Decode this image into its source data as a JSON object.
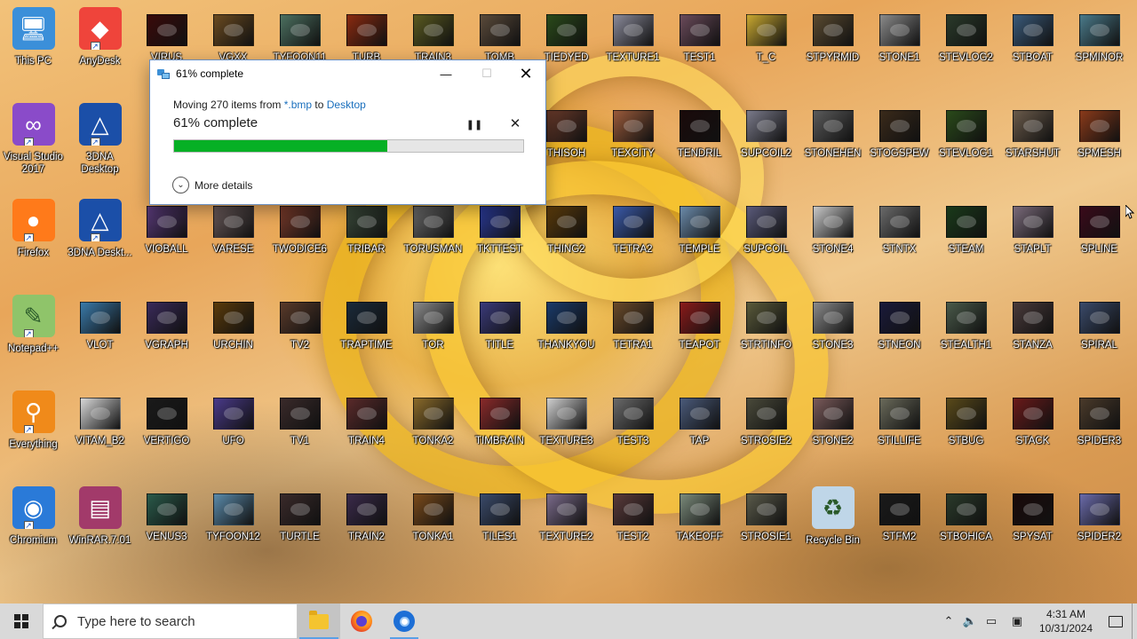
{
  "desktop": {
    "icons": [
      {
        "label": "This PC",
        "kind": "thispc",
        "col": 0,
        "row": 0,
        "shortcut": false
      },
      {
        "label": "AnyDesk",
        "kind": "anydesk",
        "col": 1,
        "row": 0,
        "shortcut": true
      },
      {
        "label": "VIRUS",
        "kind": "thumb",
        "color": "#3a0a0a",
        "col": 2,
        "row": 0
      },
      {
        "label": "VGXX",
        "kind": "thumb",
        "color": "#6a4a20",
        "col": 3,
        "row": 0
      },
      {
        "label": "TYFOON11",
        "kind": "thumb",
        "color": "#4c7060",
        "col": 4,
        "row": 0
      },
      {
        "label": "TURB",
        "kind": "thumb",
        "color": "#8a2a10",
        "col": 5,
        "row": 0
      },
      {
        "label": "TRAIN3",
        "kind": "thumb",
        "color": "#5a5a20",
        "col": 6,
        "row": 0
      },
      {
        "label": "TOMB",
        "kind": "thumb",
        "color": "#5a4a3a",
        "col": 7,
        "row": 0
      },
      {
        "label": "TIEDYED",
        "kind": "thumb",
        "color": "#2a4a1a",
        "col": 8,
        "row": 0
      },
      {
        "label": "TEXTURE1",
        "kind": "thumb",
        "color": "#8a8a9a",
        "col": 9,
        "row": 0
      },
      {
        "label": "TEST1",
        "kind": "thumb",
        "color": "#6a4a5a",
        "col": 10,
        "row": 0
      },
      {
        "label": "T_C",
        "kind": "thumb",
        "color": "#c9a830",
        "col": 11,
        "row": 0
      },
      {
        "label": "STPYRMID",
        "kind": "thumb",
        "color": "#5a4a30",
        "col": 12,
        "row": 0
      },
      {
        "label": "STONE1",
        "kind": "thumb",
        "color": "#8a8a8a",
        "col": 13,
        "row": 0
      },
      {
        "label": "STEVLOG2",
        "kind": "thumb",
        "color": "#2a3a2a",
        "col": 14,
        "row": 0
      },
      {
        "label": "STBOAT",
        "kind": "thumb",
        "color": "#3a5a7a",
        "col": 15,
        "row": 0
      },
      {
        "label": "SPMINOR",
        "kind": "thumb",
        "color": "#4a7a8a",
        "col": 16,
        "row": 0
      },
      {
        "label": "Visual Studio 2017",
        "kind": "vs",
        "col": 0,
        "row": 1,
        "shortcut": true
      },
      {
        "label": "3DNA Desktop",
        "kind": "dna",
        "col": 1,
        "row": 1,
        "shortcut": true
      },
      {
        "label": "THISOH",
        "kind": "thumb",
        "color": "#6a3a2a",
        "col": 8,
        "row": 1
      },
      {
        "label": "TEXCITY",
        "kind": "thumb",
        "color": "#9a5a3a",
        "col": 9,
        "row": 1
      },
      {
        "label": "TENDRIL",
        "kind": "thumb",
        "color": "#1a0a0a",
        "col": 10,
        "row": 1
      },
      {
        "label": "SUPCOIL2",
        "kind": "thumb",
        "color": "#7a7a8a",
        "col": 11,
        "row": 1
      },
      {
        "label": "STONEHEN",
        "kind": "thumb",
        "color": "#5a5a5a",
        "col": 12,
        "row": 1
      },
      {
        "label": "STOGSPEW",
        "kind": "thumb",
        "color": "#3a2a1a",
        "col": 13,
        "row": 1
      },
      {
        "label": "STEVLOG1",
        "kind": "thumb",
        "color": "#2a4a1a",
        "col": 14,
        "row": 1
      },
      {
        "label": "STARSHUT",
        "kind": "thumb",
        "color": "#6a5a4a",
        "col": 15,
        "row": 1
      },
      {
        "label": "SPMESH",
        "kind": "thumb",
        "color": "#8a3a1a",
        "col": 16,
        "row": 1
      },
      {
        "label": "Firefox",
        "kind": "firefox",
        "col": 0,
        "row": 2,
        "shortcut": true
      },
      {
        "label": "3DNA Deskt...",
        "kind": "dna",
        "col": 1,
        "row": 2,
        "shortcut": true
      },
      {
        "label": "VIOBALL",
        "kind": "thumb",
        "color": "#5a3a7a",
        "col": 2,
        "row": 2
      },
      {
        "label": "VARESE",
        "kind": "thumb",
        "color": "#6a5a5a",
        "col": 3,
        "row": 2
      },
      {
        "label": "TWODICE6",
        "kind": "thumb",
        "color": "#7a3a2a",
        "col": 4,
        "row": 2
      },
      {
        "label": "TRIBAR",
        "kind": "thumb",
        "color": "#3a4a3a",
        "col": 5,
        "row": 2
      },
      {
        "label": "TORUSMAN",
        "kind": "thumb",
        "color": "#6a6a6a",
        "col": 6,
        "row": 2
      },
      {
        "label": "TKTTEST",
        "kind": "thumb",
        "color": "#2a3a9a",
        "col": 7,
        "row": 2
      },
      {
        "label": "THING2",
        "kind": "thumb",
        "color": "#5a3a0a",
        "col": 8,
        "row": 2
      },
      {
        "label": "TETRA2",
        "kind": "thumb",
        "color": "#3a5aaa",
        "col": 9,
        "row": 2
      },
      {
        "label": "TEMPLE",
        "kind": "thumb",
        "color": "#6a8aaa",
        "col": 10,
        "row": 2
      },
      {
        "label": "SUPCOIL",
        "kind": "thumb",
        "color": "#5a5a7a",
        "col": 11,
        "row": 2
      },
      {
        "label": "STONE4",
        "kind": "thumb",
        "color": "#c8c8c8",
        "col": 12,
        "row": 2
      },
      {
        "label": "STNTX",
        "kind": "thumb",
        "color": "#6a6a6a",
        "col": 13,
        "row": 2
      },
      {
        "label": "STEAM",
        "kind": "thumb",
        "color": "#1a3a1a",
        "col": 14,
        "row": 2
      },
      {
        "label": "STAPLT",
        "kind": "thumb",
        "color": "#7a6a7a",
        "col": 15,
        "row": 2
      },
      {
        "label": "SPLINE",
        "kind": "thumb",
        "color": "#3a0a1a",
        "col": 16,
        "row": 2
      },
      {
        "label": "Notepad++",
        "kind": "notepad",
        "col": 0,
        "row": 3,
        "shortcut": true
      },
      {
        "label": "VLOT",
        "kind": "thumb",
        "color": "#3a7aaa",
        "col": 1,
        "row": 3
      },
      {
        "label": "VGRAPH",
        "kind": "thumb",
        "color": "#3a2a5a",
        "col": 2,
        "row": 3
      },
      {
        "label": "URCHIN",
        "kind": "thumb",
        "color": "#5a3a0a",
        "col": 3,
        "row": 3
      },
      {
        "label": "TV2",
        "kind": "thumb",
        "color": "#5a3a2a",
        "col": 4,
        "row": 3
      },
      {
        "label": "TRAPTIME",
        "kind": "thumb",
        "color": "#1a2a3a",
        "col": 5,
        "row": 3
      },
      {
        "label": "TOR",
        "kind": "thumb",
        "color": "#8a8a8a",
        "col": 6,
        "row": 3
      },
      {
        "label": "TITLE",
        "kind": "thumb",
        "color": "#3a3a7a",
        "col": 7,
        "row": 3
      },
      {
        "label": "THANKYOU",
        "kind": "thumb",
        "color": "#1a3a6a",
        "col": 8,
        "row": 3
      },
      {
        "label": "TETRA1",
        "kind": "thumb",
        "color": "#6a4a2a",
        "col": 9,
        "row": 3
      },
      {
        "label": "TEAPOT",
        "kind": "thumb",
        "color": "#8a1a1a",
        "col": 10,
        "row": 3
      },
      {
        "label": "STRTINFO",
        "kind": "thumb",
        "color": "#5a5a3a",
        "col": 11,
        "row": 3
      },
      {
        "label": "STONE3",
        "kind": "thumb",
        "color": "#8a8a8a",
        "col": 12,
        "row": 3
      },
      {
        "label": "STNEON",
        "kind": "thumb",
        "color": "#1a1a3a",
        "col": 13,
        "row": 3
      },
      {
        "label": "STEALTH1",
        "kind": "thumb",
        "color": "#4a5a4a",
        "col": 14,
        "row": 3
      },
      {
        "label": "STANZA",
        "kind": "thumb",
        "color": "#4a3a3a",
        "col": 15,
        "row": 3
      },
      {
        "label": "SPIRAL",
        "kind": "thumb",
        "color": "#3a4a6a",
        "col": 16,
        "row": 3
      },
      {
        "label": "Everything",
        "kind": "everything",
        "col": 0,
        "row": 4,
        "shortcut": true
      },
      {
        "label": "VITAM_B2",
        "kind": "thumb",
        "color": "#d8d8d8",
        "col": 1,
        "row": 4
      },
      {
        "label": "VERTIGO",
        "kind": "thumb",
        "color": "#1a1a1a",
        "col": 2,
        "row": 4
      },
      {
        "label": "UFO",
        "kind": "thumb",
        "color": "#4a3a8a",
        "col": 3,
        "row": 4
      },
      {
        "label": "TV1",
        "kind": "thumb",
        "color": "#3a2a2a",
        "col": 4,
        "row": 4
      },
      {
        "label": "TRAIN4",
        "kind": "thumb",
        "color": "#5a2a2a",
        "col": 5,
        "row": 4
      },
      {
        "label": "TONKA2",
        "kind": "thumb",
        "color": "#8a6a2a",
        "col": 6,
        "row": 4
      },
      {
        "label": "TIMBRAIN",
        "kind": "thumb",
        "color": "#8a2a2a",
        "col": 7,
        "row": 4
      },
      {
        "label": "TEXTURE3",
        "kind": "thumb",
        "color": "#d0d0d0",
        "col": 8,
        "row": 4
      },
      {
        "label": "TEST3",
        "kind": "thumb",
        "color": "#6a6a6a",
        "col": 9,
        "row": 4
      },
      {
        "label": "TAP",
        "kind": "thumb",
        "color": "#4a5a7a",
        "col": 10,
        "row": 4
      },
      {
        "label": "STROSIE2",
        "kind": "thumb",
        "color": "#4a4a3a",
        "col": 11,
        "row": 4
      },
      {
        "label": "STONE2",
        "kind": "thumb",
        "color": "#7a5a5a",
        "col": 12,
        "row": 4
      },
      {
        "label": "STILLIFE",
        "kind": "thumb",
        "color": "#6a6a5a",
        "col": 13,
        "row": 4
      },
      {
        "label": "STBUG",
        "kind": "thumb",
        "color": "#5a4a1a",
        "col": 14,
        "row": 4
      },
      {
        "label": "STACK",
        "kind": "thumb",
        "color": "#6a1a1a",
        "col": 15,
        "row": 4
      },
      {
        "label": "SPIDER3",
        "kind": "thumb",
        "color": "#4a3a2a",
        "col": 16,
        "row": 4
      },
      {
        "label": "Chromium",
        "kind": "chromium",
        "col": 0,
        "row": 5,
        "shortcut": true
      },
      {
        "label": "WinRAR.7.01",
        "kind": "winrar",
        "col": 1,
        "row": 5
      },
      {
        "label": "VENUS3",
        "kind": "thumb",
        "color": "#2a5a4a",
        "col": 2,
        "row": 5
      },
      {
        "label": "TYFOON12",
        "kind": "thumb",
        "color": "#5a8aaa",
        "col": 3,
        "row": 5
      },
      {
        "label": "TURTLE",
        "kind": "thumb",
        "color": "#3a2a2a",
        "col": 4,
        "row": 5
      },
      {
        "label": "TRAIN2",
        "kind": "thumb",
        "color": "#3a2a4a",
        "col": 5,
        "row": 5
      },
      {
        "label": "TONKA1",
        "kind": "thumb",
        "color": "#7a4a1a",
        "col": 6,
        "row": 5
      },
      {
        "label": "TILES1",
        "kind": "thumb",
        "color": "#3a4a6a",
        "col": 7,
        "row": 5
      },
      {
        "label": "TEXTURE2",
        "kind": "thumb",
        "color": "#7a6a8a",
        "col": 8,
        "row": 5
      },
      {
        "label": "TEST2",
        "kind": "thumb",
        "color": "#5a3a3a",
        "col": 9,
        "row": 5
      },
      {
        "label": "TAKEOFF",
        "kind": "thumb",
        "color": "#7a8a7a",
        "col": 10,
        "row": 5
      },
      {
        "label": "STROSIE1",
        "kind": "thumb",
        "color": "#5a5a4a",
        "col": 11,
        "row": 5
      },
      {
        "label": "Recycle Bin",
        "kind": "recycle",
        "col": 12,
        "row": 5
      },
      {
        "label": "STFM2",
        "kind": "thumb",
        "color": "#1a1a1a",
        "col": 13,
        "row": 5
      },
      {
        "label": "STBOHICA",
        "kind": "thumb",
        "color": "#2a3a2a",
        "col": 14,
        "row": 5
      },
      {
        "label": "SPYSAT",
        "kind": "thumb",
        "color": "#1a0a0a",
        "col": 15,
        "row": 5
      },
      {
        "label": "SPIDER2",
        "kind": "thumb",
        "color": "#6a6aaa",
        "col": 16,
        "row": 5
      }
    ]
  },
  "dialog": {
    "title": "61% complete",
    "moving_prefix": "Moving 270 items from ",
    "source": "*.bmp",
    "to_word": " to ",
    "destination": "Desktop",
    "percent_text": "61% complete",
    "progress": 0.61,
    "more_details": "More details",
    "min_glyph": "—",
    "max_glyph": "☐",
    "close_glyph": "✕",
    "pause_glyph": "❚❚",
    "stop_glyph": "✕",
    "chevron_glyph": "⌄",
    "progress_color": "#06b025"
  },
  "taskbar": {
    "search_placeholder": "Type here to search",
    "apps": [
      {
        "name": "file-explorer",
        "active": true
      },
      {
        "name": "firefox",
        "active": false
      },
      {
        "name": "chromium",
        "active": false
      }
    ],
    "tray": {
      "chevron_glyph": "⌃",
      "volume_glyph": "🔈",
      "network_glyph": "▭",
      "notification_glyph": "▣",
      "time": "4:31 AM",
      "date": "10/31/2024"
    }
  }
}
